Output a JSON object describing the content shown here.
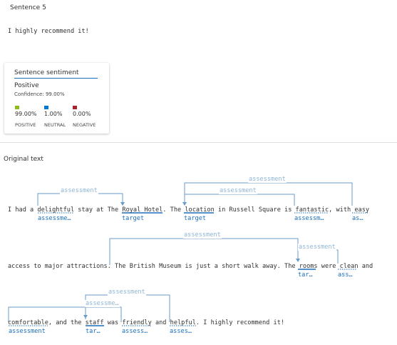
{
  "header": {
    "title": "Sentence 5",
    "sentence": "I highly recommend it!"
  },
  "sentiment_card": {
    "title": "Sentence sentiment",
    "label": "Positive",
    "confidence": "Confidence: 99.00%",
    "scores": [
      {
        "value": "99.00%",
        "name": "POSITIVE",
        "color": "#8cbd18"
      },
      {
        "value": "1.00%",
        "name": "NEUTRAL",
        "color": "#0078d4"
      },
      {
        "value": "0.00%",
        "name": "NEGATIVE",
        "color": "#a4262c"
      }
    ]
  },
  "original": {
    "heading": "Original text",
    "lines": [
      "I had a delightful stay at The Royal Hotel. The location in Russell Square is fantastic, with easy",
      "access to major attractions. The British Museum is just a short walk away. The rooms were clean and",
      "comfortable, and the staff was friendly and helpful. I highly recommend it!"
    ],
    "relation_label": "assessment",
    "arc_labels": [
      "assessment",
      "assessment",
      "assessment",
      "assessment",
      "assessment",
      "assessment",
      "assessme…"
    ],
    "tags": [
      "assessme…",
      "target",
      "target",
      "assessm…",
      "as…",
      "tar…",
      "ass…",
      "assessment",
      "tar…",
      "assess…",
      "asses…"
    ]
  }
}
